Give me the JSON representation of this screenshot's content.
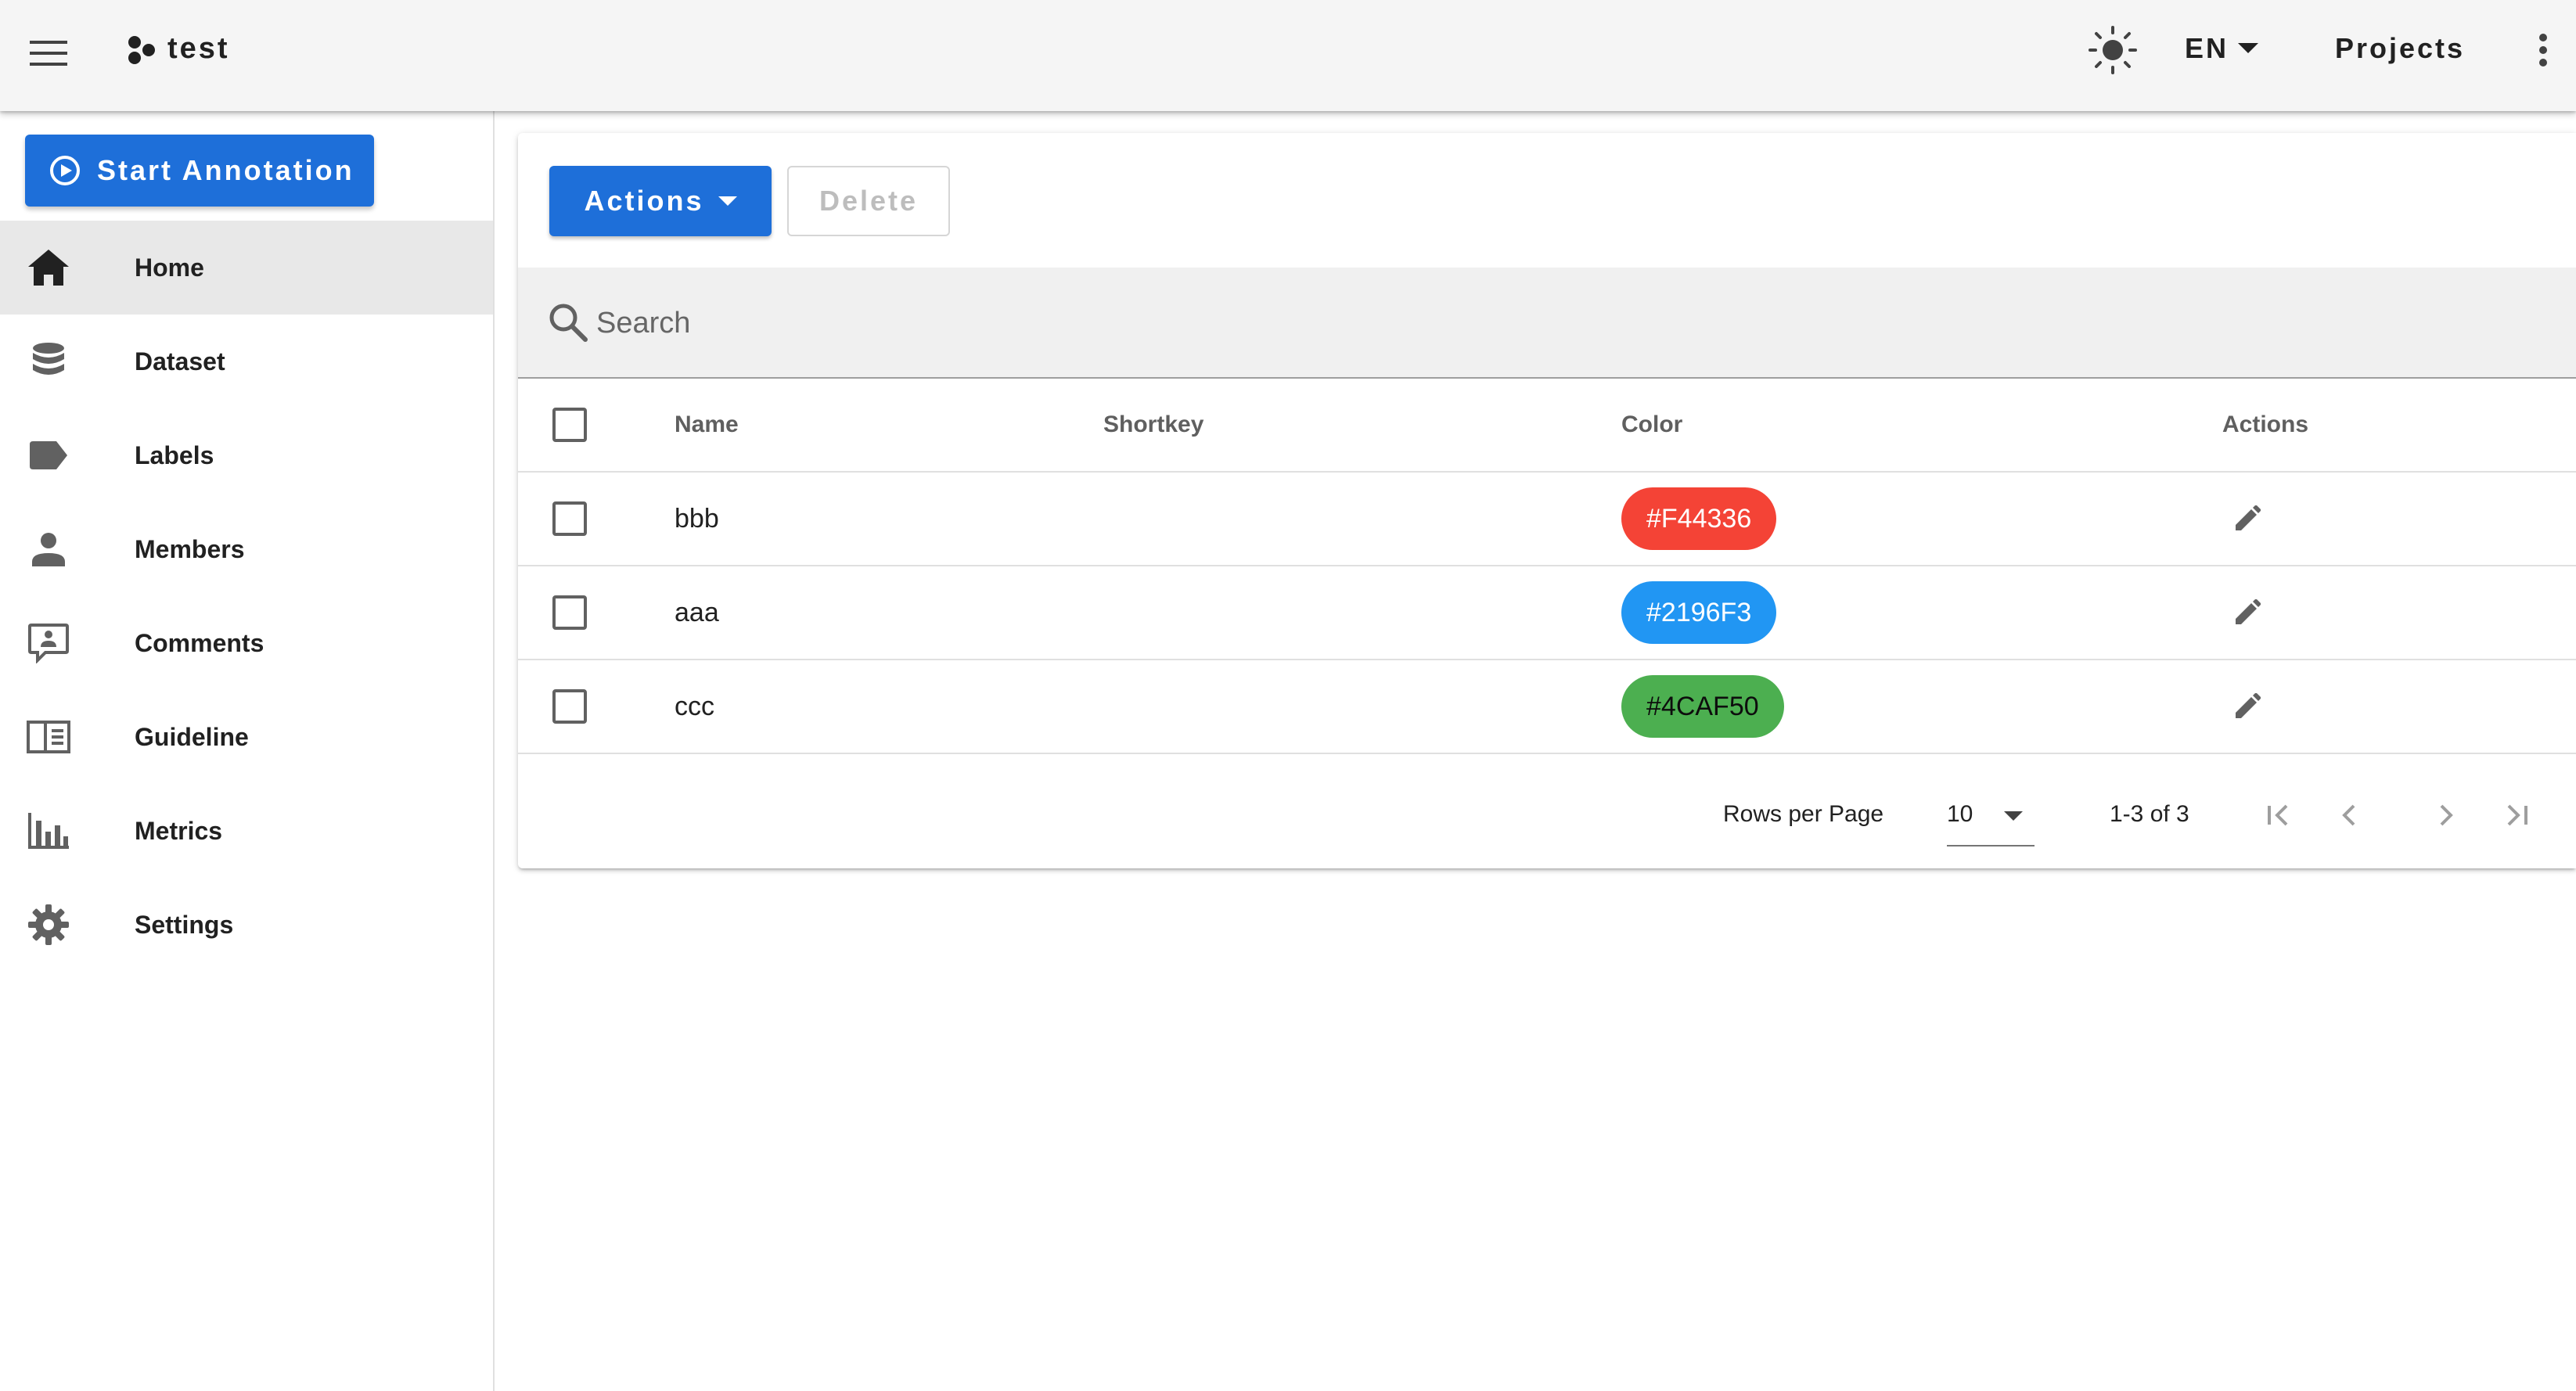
{
  "appbar": {
    "title": "test",
    "language": "EN",
    "projects_label": "Projects"
  },
  "sidebar": {
    "start_annotation_label": "Start Annotation",
    "items": [
      {
        "label": "Home",
        "icon": "home-icon",
        "active": true
      },
      {
        "label": "Dataset",
        "icon": "database-icon",
        "active": false
      },
      {
        "label": "Labels",
        "icon": "label-icon",
        "active": false
      },
      {
        "label": "Members",
        "icon": "person-icon",
        "active": false
      },
      {
        "label": "Comments",
        "icon": "comment-icon",
        "active": false
      },
      {
        "label": "Guideline",
        "icon": "book-icon",
        "active": false
      },
      {
        "label": "Metrics",
        "icon": "chart-icon",
        "active": false
      },
      {
        "label": "Settings",
        "icon": "gear-icon",
        "active": false
      }
    ]
  },
  "toolbar": {
    "actions_label": "Actions",
    "delete_label": "Delete"
  },
  "search": {
    "placeholder": "Search",
    "value": ""
  },
  "table": {
    "columns": [
      "Name",
      "Shortkey",
      "Color",
      "Actions"
    ],
    "rows": [
      {
        "name": "bbb",
        "shortkey": "",
        "color": "#F44336",
        "text_color": "#ffffff"
      },
      {
        "name": "aaa",
        "shortkey": "",
        "color": "#2196F3",
        "text_color": "#ffffff"
      },
      {
        "name": "ccc",
        "shortkey": "",
        "color": "#4CAF50",
        "text_color": "#0d0d0d"
      }
    ]
  },
  "pagination": {
    "rows_per_page_label": "Rows per Page",
    "rows_per_page": "10",
    "range_text": "1-3 of 3"
  },
  "colors": {
    "primary": "#1e6fd9",
    "appbar_bg": "#f5f5f5",
    "active_nav_bg": "#e8e8e8"
  }
}
